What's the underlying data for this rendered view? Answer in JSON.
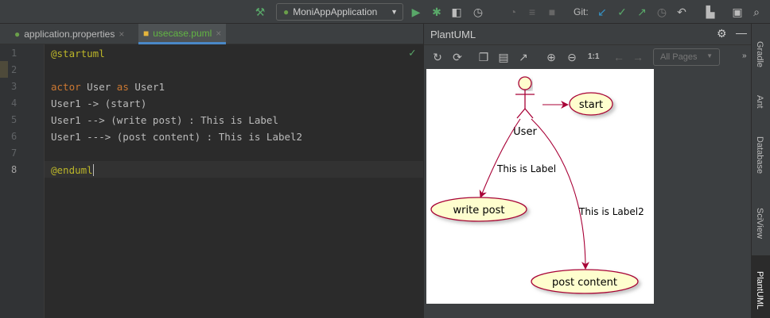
{
  "toolbar": {
    "run_config": "MoniAppApplication",
    "git_label": "Git:"
  },
  "tabs": [
    {
      "label": "application.properties",
      "close": "×"
    },
    {
      "label": "usecase.puml",
      "close": "×"
    }
  ],
  "editor": {
    "lines": [
      {
        "n": "1",
        "text": "@startuml"
      },
      {
        "n": "2",
        "text": ""
      },
      {
        "n": "3",
        "kw1": "actor",
        "mid": " User ",
        "kw2": "as",
        "rest": " User1"
      },
      {
        "n": "4",
        "text": "User1 -> (start)"
      },
      {
        "n": "5",
        "text": "User1 --> (write post) : This is Label"
      },
      {
        "n": "6",
        "text": "User1 ---> (post content) : This is Label2"
      },
      {
        "n": "7",
        "text": ""
      },
      {
        "n": "8",
        "text": "@enduml"
      }
    ]
  },
  "plantuml": {
    "title": "PlantUML",
    "zoom_reset": "1:1",
    "pages": "All Pages",
    "diagram": {
      "actor": "User",
      "usecases": [
        "start",
        "write post",
        "post content"
      ],
      "labels": [
        "This is Label",
        "This is Label2"
      ]
    }
  },
  "sidebar": [
    "Gradle",
    "Ant",
    "Database",
    "SciView",
    "PlantUML"
  ],
  "colors": {
    "accent": "#4a88c7",
    "uml_border": "#a80036",
    "uml_fill": "#fefece"
  }
}
